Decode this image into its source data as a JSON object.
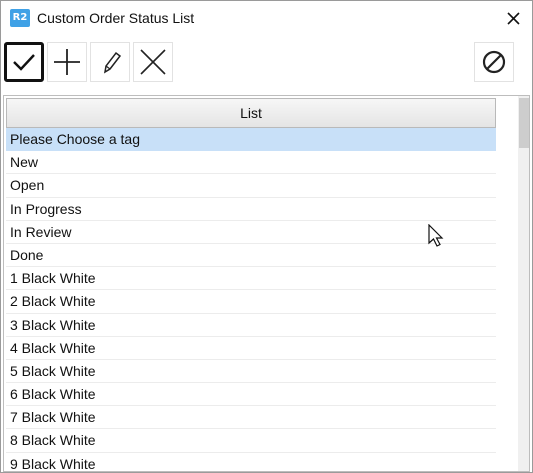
{
  "window": {
    "app_icon_text": "R2",
    "title": "Custom Order Status List"
  },
  "toolbar": {
    "buttons": [
      {
        "name": "confirm",
        "icon": "checkmark-icon",
        "selected": true
      },
      {
        "name": "add",
        "icon": "plus-icon"
      },
      {
        "name": "edit",
        "icon": "pencil-icon"
      },
      {
        "name": "delete",
        "icon": "x-icon"
      },
      {
        "name": "cancel",
        "icon": "no-entry-icon"
      }
    ]
  },
  "list": {
    "header": "List",
    "selected_index": 0,
    "items": [
      "Please Choose a tag",
      "New",
      "Open",
      "In Progress",
      "In Review",
      "Done",
      "1 Black White",
      "2 Black White",
      "3 Black White",
      "4 Black White",
      "5 Black White",
      "6 Black White",
      "7 Black White",
      "8 Black White",
      "9 Black White"
    ]
  },
  "colors": {
    "selection": "#c8e0f8",
    "app_icon": "#3fa1e6"
  }
}
